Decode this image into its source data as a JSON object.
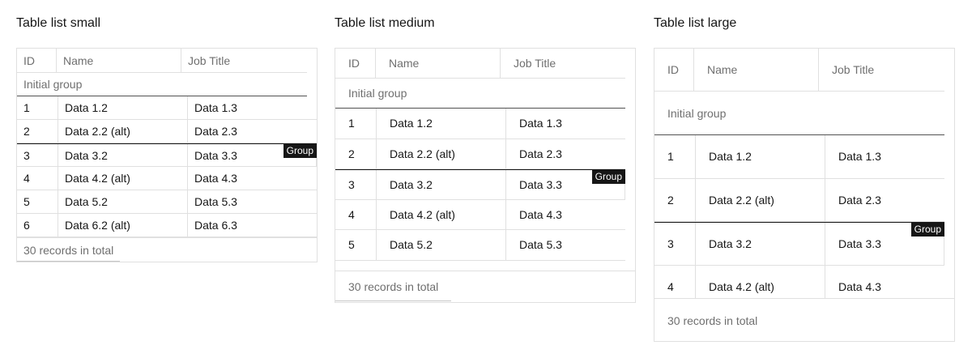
{
  "tables": [
    {
      "title": "Table list small",
      "headers": [
        "ID",
        "Name",
        "Job Title"
      ],
      "group": "Initial group",
      "group_tag": "Group",
      "rows": [
        [
          "1",
          "Data 1.2",
          "Data 1.3"
        ],
        [
          "2",
          "Data 2.2 (alt)",
          "Data 2.3"
        ],
        [
          "3",
          "Data 3.2",
          "Data 3.3"
        ],
        [
          "4",
          "Data 4.2 (alt)",
          "Data 4.3"
        ],
        [
          "5",
          "Data 5.2",
          "Data 5.3"
        ],
        [
          "6",
          "Data 6.2 (alt)",
          "Data 6.3"
        ]
      ],
      "footer": "30 records in total"
    },
    {
      "title": "Table list medium",
      "headers": [
        "ID",
        "Name",
        "Job Title"
      ],
      "group": "Initial group",
      "group_tag": "Group",
      "rows": [
        [
          "1",
          "Data 1.2",
          "Data 1.3"
        ],
        [
          "2",
          "Data 2.2 (alt)",
          "Data 2.3"
        ],
        [
          "3",
          "Data 3.2",
          "Data 3.3"
        ],
        [
          "4",
          "Data 4.2 (alt)",
          "Data 4.3"
        ],
        [
          "5",
          "Data 5.2",
          "Data 5.3"
        ]
      ],
      "footer": "30 records in total"
    },
    {
      "title": "Table list large",
      "headers": [
        "ID",
        "Name",
        "Job Title"
      ],
      "group": "Initial group",
      "group_tag": "Group",
      "rows": [
        [
          "1",
          "Data 1.2",
          "Data 1.3"
        ],
        [
          "2",
          "Data 2.2 (alt)",
          "Data 2.3"
        ],
        [
          "3",
          "Data 3.2",
          "Data 3.3"
        ],
        [
          "4",
          "Data 4.2 (alt)",
          "Data 4.3"
        ]
      ],
      "footer": "30 records in total"
    }
  ],
  "colors": {
    "text": "#161616",
    "muted": "#6f6f6f",
    "border": "#e0e0e0",
    "tag_bg": "#161616",
    "tag_text": "#ffffff"
  }
}
